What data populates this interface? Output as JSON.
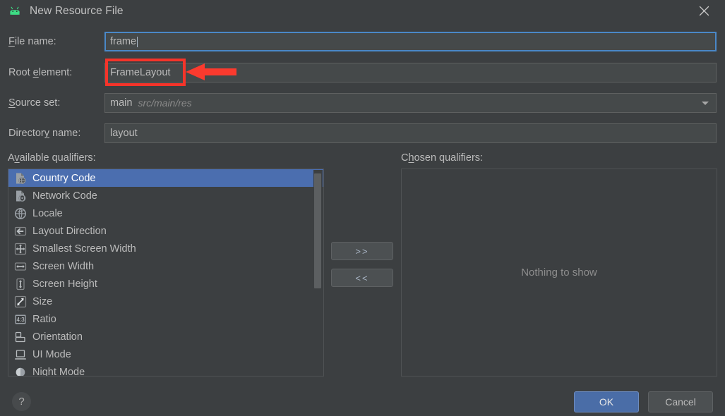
{
  "window": {
    "title": "New Resource File",
    "app_icon": "android-robot-icon",
    "close_icon": "close-icon"
  },
  "form": {
    "file_name": {
      "label": "File name:",
      "label_mnemonic": "F",
      "value": "frame",
      "focused": true
    },
    "root_element": {
      "label": "Root element:",
      "label_mnemonic": "e",
      "value": "FrameLayout",
      "highlighted": true
    },
    "source_set": {
      "label": "Source set:",
      "label_mnemonic": "S",
      "value": "main",
      "path_hint": "src/main/res",
      "dropdown_icon": "chevron-down-icon"
    },
    "directory_name": {
      "label": "Directory name:",
      "label_mnemonic": "y",
      "value": "layout"
    }
  },
  "qualifiers": {
    "available_label": "Available qualifiers:",
    "available_label_mnemonic": "v",
    "chosen_label": "Chosen qualifiers:",
    "chosen_label_mnemonic": "h",
    "chosen_empty_text": "Nothing to show",
    "available_items": [
      {
        "label": "Country Code",
        "icon": "country-code-icon",
        "selected": true
      },
      {
        "label": "Network Code",
        "icon": "network-code-icon",
        "selected": false
      },
      {
        "label": "Locale",
        "icon": "globe-icon",
        "selected": false
      },
      {
        "label": "Layout Direction",
        "icon": "arrow-left-icon",
        "selected": false
      },
      {
        "label": "Smallest Screen Width",
        "icon": "four-arrows-icon",
        "selected": false
      },
      {
        "label": "Screen Width",
        "icon": "arrow-horizontal-icon",
        "selected": false
      },
      {
        "label": "Screen Height",
        "icon": "arrow-vertical-icon",
        "selected": false
      },
      {
        "label": "Size",
        "icon": "diagonal-arrow-icon",
        "selected": false
      },
      {
        "label": "Ratio",
        "icon": "ratio-icon",
        "selected": false
      },
      {
        "label": "Orientation",
        "icon": "orientation-icon",
        "selected": false
      },
      {
        "label": "UI Mode",
        "icon": "ui-mode-icon",
        "selected": false
      },
      {
        "label": "Night Mode",
        "icon": "night-mode-icon",
        "selected": false
      }
    ],
    "add_button": ">>",
    "remove_button": "<<"
  },
  "footer": {
    "help_label": "?",
    "ok_label": "OK",
    "cancel_label": "Cancel"
  },
  "annotation": {
    "type": "red-callout",
    "color": "#f5342a",
    "target": "Root element field value"
  },
  "colors": {
    "dialog_bg": "#3c3f41",
    "field_bg": "#45494a",
    "selection_blue": "#4b6eaf",
    "focus_blue": "#4a88c7",
    "ok_blue": "#4a6da7",
    "annotation_red": "#f5342a"
  }
}
